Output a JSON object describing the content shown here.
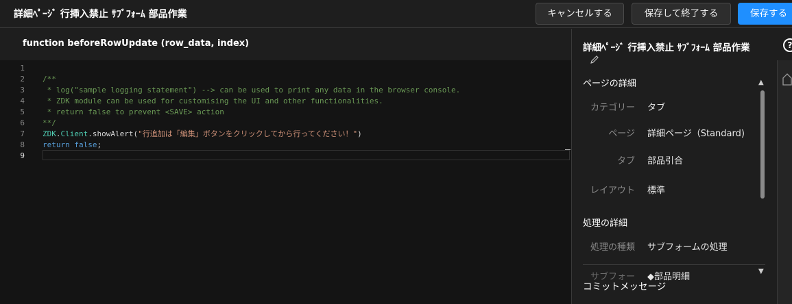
{
  "header": {
    "title": "詳細ﾍﾟｰｼﾞ 行挿入禁止 ｻﾌﾞﾌｫｰﾑ 部品作業",
    "cancel_label": "キャンセルする",
    "save_exit_label": "保存して終了する",
    "save_label": "保存する"
  },
  "editor": {
    "function_signature": "function beforeRowUpdate (row_data, index)",
    "active_line": 9,
    "lines": [
      {
        "num": "1",
        "tokens": []
      },
      {
        "num": "2",
        "tokens": [
          {
            "cls": "c-comment",
            "text": "/**"
          }
        ]
      },
      {
        "num": "3",
        "tokens": [
          {
            "cls": "c-comment",
            "text": " * log(\"sample logging statement\") --> can be used to print any data in the browser console."
          }
        ]
      },
      {
        "num": "4",
        "tokens": [
          {
            "cls": "c-comment",
            "text": " * ZDK module can be used for customising the UI and other functionalities."
          }
        ]
      },
      {
        "num": "5",
        "tokens": [
          {
            "cls": "c-comment",
            "text": " * return false to prevent <SAVE> action"
          }
        ]
      },
      {
        "num": "6",
        "tokens": [
          {
            "cls": "c-comment",
            "text": "**/"
          }
        ]
      },
      {
        "num": "7",
        "tokens": [
          {
            "cls": "c-obj",
            "text": "ZDK"
          },
          {
            "cls": "c-plain",
            "text": "."
          },
          {
            "cls": "c-obj",
            "text": "Client"
          },
          {
            "cls": "c-plain",
            "text": ".showAlert("
          },
          {
            "cls": "c-str",
            "text": "\"行追加は「編集」ボタンをクリックしてから行ってください！\""
          },
          {
            "cls": "c-plain",
            "text": ")"
          }
        ]
      },
      {
        "num": "8",
        "tokens": [
          {
            "cls": "c-kw",
            "text": "return"
          },
          {
            "cls": "c-plain",
            "text": " "
          },
          {
            "cls": "c-kw",
            "text": "false"
          },
          {
            "cls": "c-plain",
            "text": ";"
          }
        ]
      },
      {
        "num": "9",
        "tokens": []
      }
    ]
  },
  "panel": {
    "title": "詳細ﾍﾟｰｼﾞ 行挿入禁止 ｻﾌﾞﾌｫｰﾑ 部品作業",
    "help_glyph": "?",
    "page_details_heading": "ページの詳細",
    "page_details": [
      {
        "label": "カテゴリー",
        "value": "タブ"
      },
      {
        "label": "ページ",
        "value": "詳細ページ（Standard)"
      },
      {
        "label": "タブ",
        "value": "部品引合"
      },
      {
        "label": "レイアウト",
        "value": "標準"
      }
    ],
    "process_details_heading": "処理の詳細",
    "process_details": [
      {
        "label": "処理の種類",
        "value": "サブフォームの処理"
      },
      {
        "label": "サブフォー",
        "value": "◆部品明細"
      }
    ],
    "commit_message_label": "コミットメッセージ"
  },
  "icons": {
    "edit": "pencil-icon",
    "help": "help-icon",
    "scroll_up": "triangle-up-icon",
    "scroll_down": "triangle-down-icon",
    "side": "side-panel-icon"
  },
  "colors": {
    "primary_button": "#1f8fff",
    "background": "#1e1e1e",
    "editor_background": "#141414"
  }
}
